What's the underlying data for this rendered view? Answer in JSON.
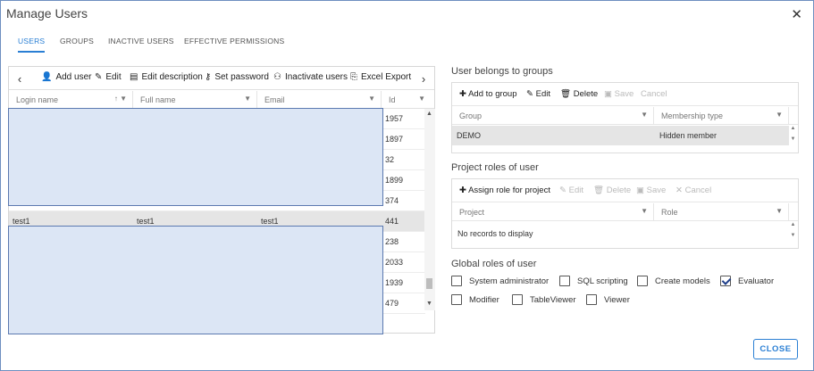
{
  "dialog": {
    "title": "Manage Users"
  },
  "tabs": [
    {
      "label": "USERS",
      "active": true
    },
    {
      "label": "GROUPS",
      "active": false
    },
    {
      "label": "INACTIVE USERS",
      "active": false
    },
    {
      "label": "EFFECTIVE PERMISSIONS",
      "active": false
    }
  ],
  "toolbar": {
    "add_user": "Add user",
    "edit": "Edit",
    "edit_description": "Edit description",
    "set_password": "Set password",
    "inactivate_users": "Inactivate users",
    "excel_export": "Excel Export"
  },
  "grid": {
    "columns": [
      "Login name",
      "Full name",
      "Email",
      "Id"
    ],
    "rows": [
      {
        "login": "",
        "full": "",
        "email": "",
        "id": "1957"
      },
      {
        "login": "",
        "full": "",
        "email": "",
        "id": "1897"
      },
      {
        "login": "",
        "full": "",
        "email": "",
        "id": "32"
      },
      {
        "login": "",
        "full": "",
        "email": "",
        "id": "1899"
      },
      {
        "login": "",
        "full": "",
        "email": "",
        "id": "374"
      },
      {
        "login": "test1",
        "full": "test1",
        "email": "test1",
        "id": "441"
      },
      {
        "login": "",
        "full": "",
        "email": "",
        "id": "238"
      },
      {
        "login": "",
        "full": "",
        "email": "",
        "id": "2033"
      },
      {
        "login": "",
        "full": "",
        "email": "",
        "id": "1939"
      },
      {
        "login": "",
        "full": "",
        "email": "",
        "id": "479"
      }
    ]
  },
  "groups_section": {
    "title": "User belongs to groups",
    "toolbar": {
      "add": "Add to group",
      "edit": "Edit",
      "delete": "Delete",
      "save": "Save",
      "cancel": "Cancel"
    },
    "columns": [
      "Group",
      "Membership type"
    ],
    "rows": [
      {
        "group": "DEMO",
        "type": "Hidden member"
      }
    ]
  },
  "roles_section": {
    "title": "Project roles of user",
    "toolbar": {
      "assign": "Assign role for project",
      "edit": "Edit",
      "delete": "Delete",
      "save": "Save",
      "cancel": "Cancel"
    },
    "columns": [
      "Project",
      "Role"
    ],
    "empty": "No records to display"
  },
  "global_roles": {
    "title": "Global roles of user",
    "items": [
      {
        "label": "System administrator",
        "checked": false
      },
      {
        "label": "SQL scripting",
        "checked": false
      },
      {
        "label": "Create models",
        "checked": false
      },
      {
        "label": "Evaluator",
        "checked": true
      },
      {
        "label": "Modifier",
        "checked": false
      },
      {
        "label": "TableViewer",
        "checked": false
      },
      {
        "label": "Viewer",
        "checked": false
      }
    ]
  },
  "footer": {
    "close": "CLOSE"
  }
}
